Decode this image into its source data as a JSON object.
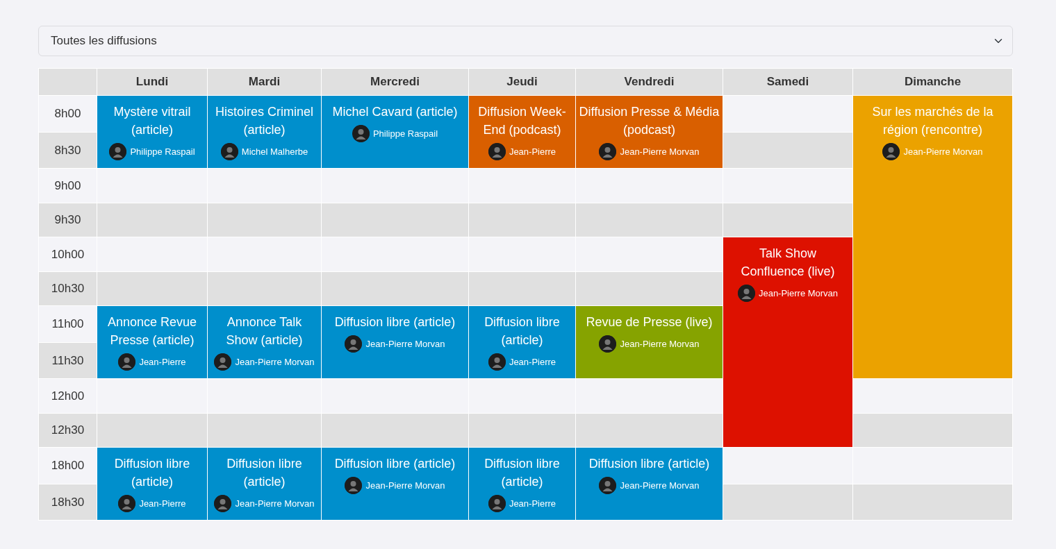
{
  "filter": {
    "value": "Toutes les diffusions"
  },
  "days": [
    "Lundi",
    "Mardi",
    "Mercredi",
    "Jeudi",
    "Vendredi",
    "Samedi",
    "Dimanche"
  ],
  "rows": [
    {
      "time": "8h00",
      "cells": [
        {
          "kind": "event",
          "title": "Mystère vitrail (article)",
          "author": "Philippe Raspail",
          "color": "#008fcc"
        },
        {
          "kind": "event",
          "title": "Histoires Criminel (article)",
          "author": "Michel Malherbe",
          "color": "#008fcc"
        },
        {
          "kind": "event",
          "title": "Michel Cavard (article)",
          "author": "Philippe Raspail",
          "color": "#008fcc"
        },
        {
          "kind": "event",
          "title": "Diffusion Week-End (podcast)",
          "author": "Jean-Pierre",
          "color": "#d95f00"
        },
        {
          "kind": "event",
          "title": "Diffusion Presse & Média (podcast)",
          "author": "Jean-Pierre Morvan",
          "color": "#d95f00"
        },
        {
          "kind": "empty"
        },
        {
          "kind": "event",
          "title": "Sur les marchés de la région (rencontre)",
          "author": "Jean-Pierre Morvan",
          "color": "#eba200"
        }
      ]
    },
    {
      "time": "8h30",
      "cells": [
        {
          "kind": "continued"
        },
        {
          "kind": "continued"
        },
        {
          "kind": "continued"
        },
        {
          "kind": "continued"
        },
        {
          "kind": "continued"
        },
        {
          "kind": "empty"
        },
        {
          "kind": "continued"
        }
      ]
    },
    {
      "time": "9h00",
      "cells": [
        {
          "kind": "empty"
        },
        {
          "kind": "empty"
        },
        {
          "kind": "empty"
        },
        {
          "kind": "empty"
        },
        {
          "kind": "empty"
        },
        {
          "kind": "empty"
        },
        {
          "kind": "continued"
        }
      ]
    },
    {
      "time": "9h30",
      "cells": [
        {
          "kind": "empty"
        },
        {
          "kind": "empty"
        },
        {
          "kind": "empty"
        },
        {
          "kind": "empty"
        },
        {
          "kind": "empty"
        },
        {
          "kind": "empty"
        },
        {
          "kind": "continued"
        }
      ]
    },
    {
      "time": "10h00",
      "cells": [
        {
          "kind": "empty"
        },
        {
          "kind": "empty"
        },
        {
          "kind": "empty"
        },
        {
          "kind": "empty"
        },
        {
          "kind": "empty"
        },
        {
          "kind": "event",
          "title": "Talk Show Confluence (live)",
          "author": "Jean-Pierre Morvan",
          "color": "#dd1100"
        },
        {
          "kind": "continued"
        }
      ]
    },
    {
      "time": "10h30",
      "cells": [
        {
          "kind": "empty"
        },
        {
          "kind": "empty"
        },
        {
          "kind": "empty"
        },
        {
          "kind": "empty"
        },
        {
          "kind": "empty"
        },
        {
          "kind": "continued"
        },
        {
          "kind": "continued"
        }
      ]
    },
    {
      "time": "11h00",
      "cells": [
        {
          "kind": "event",
          "title": "Annonce Revue Presse (article)",
          "author": "Jean-Pierre",
          "color": "#008fcc"
        },
        {
          "kind": "event",
          "title": "Annonce Talk Show (article)",
          "author": "Jean-Pierre Morvan",
          "color": "#008fcc"
        },
        {
          "kind": "event",
          "title": "Diffusion libre (article)",
          "author": "Jean-Pierre Morvan",
          "color": "#008fcc"
        },
        {
          "kind": "event",
          "title": "Diffusion libre (article)",
          "author": "Jean-Pierre",
          "color": "#008fcc"
        },
        {
          "kind": "event",
          "title": "Revue de Presse (live)",
          "author": "Jean-Pierre Morvan",
          "color": "#86a300"
        },
        {
          "kind": "continued"
        },
        {
          "kind": "continued"
        }
      ]
    },
    {
      "time": "11h30",
      "cells": [
        {
          "kind": "continued"
        },
        {
          "kind": "continued"
        },
        {
          "kind": "continued"
        },
        {
          "kind": "continued"
        },
        {
          "kind": "continued"
        },
        {
          "kind": "continued"
        },
        {
          "kind": "continued"
        }
      ]
    },
    {
      "time": "12h00",
      "cells": [
        {
          "kind": "empty"
        },
        {
          "kind": "empty"
        },
        {
          "kind": "empty"
        },
        {
          "kind": "empty"
        },
        {
          "kind": "empty"
        },
        {
          "kind": "continued"
        },
        {
          "kind": "empty"
        }
      ]
    },
    {
      "time": "12h30",
      "cells": [
        {
          "kind": "empty"
        },
        {
          "kind": "empty"
        },
        {
          "kind": "empty"
        },
        {
          "kind": "empty"
        },
        {
          "kind": "empty"
        },
        {
          "kind": "continued"
        },
        {
          "kind": "empty"
        }
      ]
    },
    {
      "time": "18h00",
      "cells": [
        {
          "kind": "event",
          "title": "Diffusion libre (article)",
          "author": "Jean-Pierre",
          "color": "#008fcc"
        },
        {
          "kind": "event",
          "title": "Diffusion libre (article)",
          "author": "Jean-Pierre Morvan",
          "color": "#008fcc"
        },
        {
          "kind": "event",
          "title": "Diffusion libre (article)",
          "author": "Jean-Pierre Morvan",
          "color": "#008fcc"
        },
        {
          "kind": "event",
          "title": "Diffusion libre (article)",
          "author": "Jean-Pierre",
          "color": "#008fcc"
        },
        {
          "kind": "event",
          "title": "Diffusion libre (article)",
          "author": "Jean-Pierre Morvan",
          "color": "#008fcc"
        },
        {
          "kind": "empty"
        },
        {
          "kind": "empty"
        }
      ]
    },
    {
      "time": "18h30",
      "cells": [
        {
          "kind": "continued"
        },
        {
          "kind": "continued"
        },
        {
          "kind": "continued"
        },
        {
          "kind": "continued"
        },
        {
          "kind": "continued"
        },
        {
          "kind": "empty"
        },
        {
          "kind": "empty"
        }
      ]
    }
  ]
}
